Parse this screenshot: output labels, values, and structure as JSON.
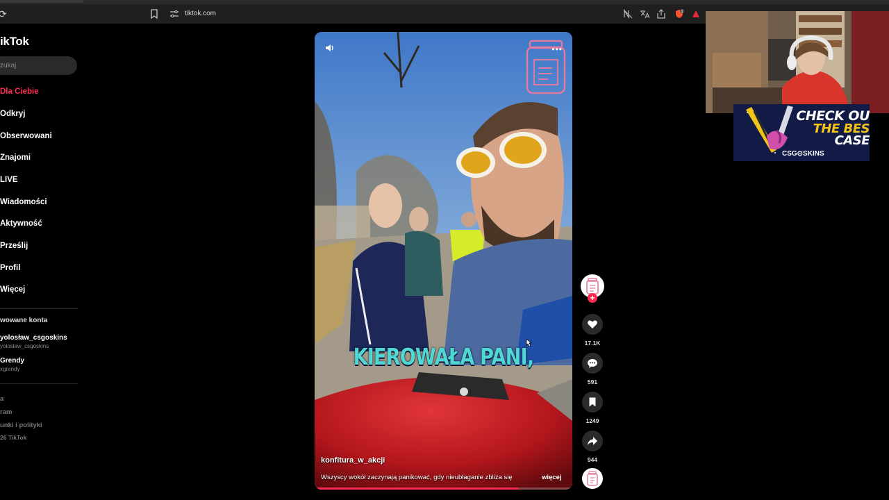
{
  "browser": {
    "url": "tiktok.com",
    "icons": [
      "reload-icon",
      "bookmark-icon",
      "site-settings-icon",
      "no-translate-icon",
      "translate-icon",
      "share-icon",
      "brave-shield-icon",
      "brave-rewards-icon"
    ]
  },
  "sidebar": {
    "logo": "ikTok",
    "search_placeholder": "zukaj",
    "nav": [
      {
        "label": "Dla Ciebie",
        "active": true
      },
      {
        "label": "Odkryj"
      },
      {
        "label": "Obserwowani"
      },
      {
        "label": "Znajomi"
      },
      {
        "label": "LIVE"
      },
      {
        "label": "Wiadomości"
      },
      {
        "label": "Aktywność"
      },
      {
        "label": "Prześlij"
      },
      {
        "label": "Profil"
      },
      {
        "label": "Więcej"
      }
    ],
    "followed_title": "wowane konta",
    "accounts": [
      {
        "name": "yolosław_csgoskins",
        "handle": "yolosław_csgoskins"
      },
      {
        "name": "Grendy",
        "handle": "xgrendy"
      }
    ],
    "footer": [
      "a",
      "ram",
      "unki i polityki",
      "26 TikTok"
    ]
  },
  "video": {
    "caption": "KIEROWAŁA PANI,",
    "author": "konfitura_w_akcji",
    "description": "Wszyscy wokół zaczynają panikować, gdy nieubłaganie zbliża się",
    "more": "więcej",
    "progress": 0.79
  },
  "actions": {
    "likes": "17.1K",
    "comments": "591",
    "saves": "1249",
    "shares": "944"
  },
  "ad": {
    "line1": "CHECK OU",
    "line2": "THE BES",
    "line3": "CASE",
    "brand": "CSG⊙SKINS"
  },
  "colors": {
    "accent": "#fe2c55",
    "caption": "#4fd8d6",
    "ad_bg": "#121a46",
    "ad_yellow": "#f2c318"
  }
}
